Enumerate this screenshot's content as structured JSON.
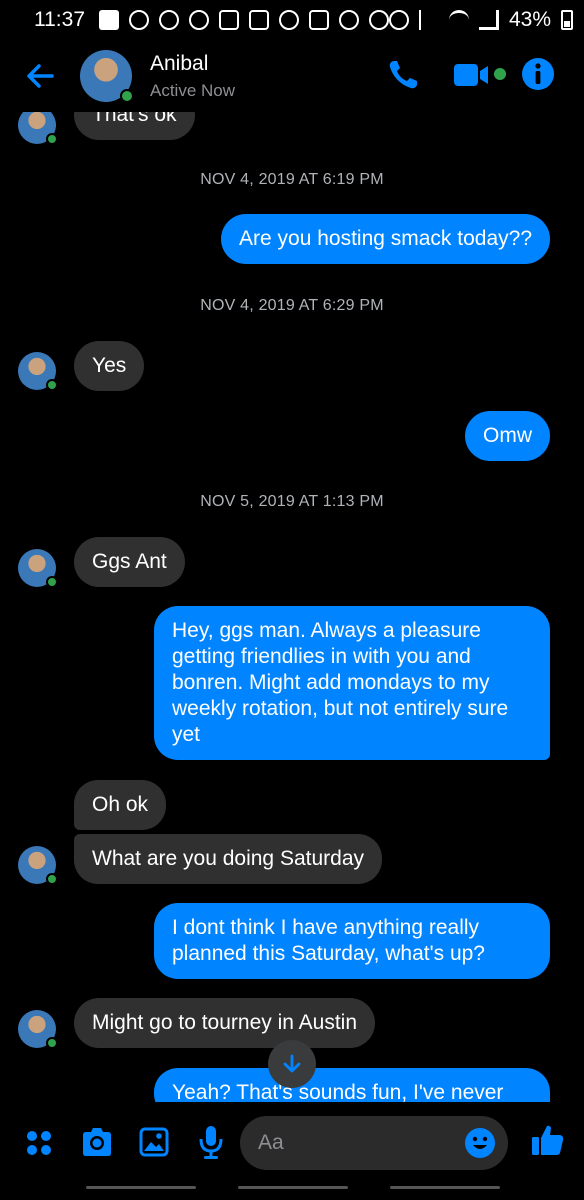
{
  "status_bar": {
    "time": "11:37",
    "battery": "43%"
  },
  "header": {
    "contact_name": "Anibal",
    "status": "Active Now"
  },
  "colors": {
    "accent": "#0084ff",
    "online": "#31a24c",
    "incoming_bubble": "#303030",
    "background": "#000000"
  },
  "icons": [
    "back-arrow-icon",
    "phone-icon",
    "video-icon",
    "info-icon",
    "apps-icon",
    "camera-icon",
    "gallery-icon",
    "microphone-icon",
    "emoji-icon",
    "thumbs-up-icon",
    "arrow-down-icon"
  ],
  "messages": {
    "partial_top": "That's ok",
    "ts1": "NOV 4, 2019 AT 6:19 PM",
    "m1": "Are you hosting smack today??",
    "ts2": "NOV 4, 2019 AT 6:29 PM",
    "m2": "Yes",
    "m3": "Omw",
    "ts3": "NOV 5, 2019 AT 1:13 PM",
    "m4": "Ggs Ant",
    "m5": "Hey, ggs man. Always a pleasure getting friendlies in with you and bonren. Might add mondays to my weekly rotation, but not entirely sure yet",
    "m6": "Oh ok",
    "m7": "What are you doing Saturday",
    "m8": "I dont think I have anything really planned this Saturday, what's up?",
    "m9": "Might go to tourney in Austin",
    "m10": "Yeah? That's sounds fun, I've never"
  },
  "composer": {
    "placeholder": "Aa"
  }
}
